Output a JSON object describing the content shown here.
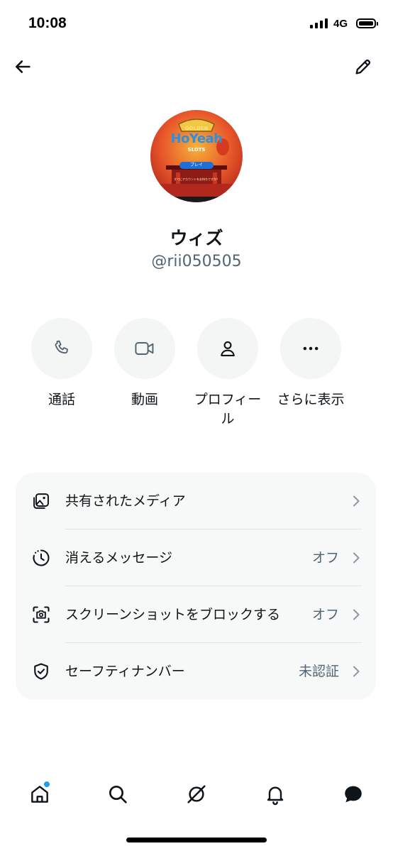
{
  "status_bar": {
    "time": "10:08",
    "network": "4G"
  },
  "header": {
    "back_icon": "arrow-left-icon",
    "edit_icon": "pencil-icon"
  },
  "profile": {
    "display_name": "ウィズ",
    "handle": "@rii050505",
    "avatar": {
      "title_top": "GOLDEN",
      "title_main": "HoYeah",
      "title_sub": "SLOTS",
      "play_button": "プレイ",
      "footer_text": "すでにアカウントをお持ちですか？"
    }
  },
  "actions": [
    {
      "label": "通話",
      "icon": "phone-icon"
    },
    {
      "label": "動画",
      "icon": "video-camera-icon"
    },
    {
      "label": "プロフィール",
      "icon": "person-icon"
    },
    {
      "label": "さらに表示",
      "icon": "more-dots-icon"
    }
  ],
  "settings": [
    {
      "label": "共有されたメディア",
      "value": "",
      "icon": "shared-media-icon"
    },
    {
      "label": "消えるメッセージ",
      "value": "オフ",
      "icon": "timer-icon"
    },
    {
      "label": "スクリーンショットをブロックする",
      "value": "オフ",
      "icon": "screenshot-block-icon"
    },
    {
      "label": "セーフティナンバー",
      "value": "未認証",
      "icon": "shield-check-icon"
    }
  ],
  "tab_bar": {
    "tabs": [
      "home-icon",
      "search-icon",
      "grok-icon",
      "notifications-icon",
      "messages-icon"
    ],
    "active": "messages-icon",
    "notification_dot_color": "#1d9bf0"
  },
  "colors": {
    "primary_text": "#0f1419",
    "secondary_text": "#536471",
    "card_background": "#f7f8f8",
    "action_circle": "#f4f5f5"
  }
}
